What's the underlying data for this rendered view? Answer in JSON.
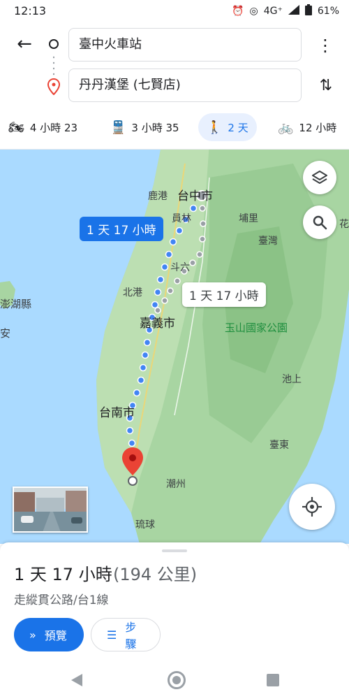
{
  "status_bar": {
    "time": "12:13",
    "network": "4G⁺",
    "battery": "61%"
  },
  "directions": {
    "origin": "臺中火車站",
    "destination": "丹丹漢堡 (七賢店)"
  },
  "modes": [
    {
      "icon": "motorcycle-icon",
      "label": "4 小時 23"
    },
    {
      "icon": "transit-icon",
      "label": "3 小時 35"
    },
    {
      "icon": "walk-icon",
      "label": "2 天",
      "active": true
    },
    {
      "icon": "bicycle-icon",
      "label": "12 小時"
    }
  ],
  "map": {
    "labels": {
      "taichung": "台中市",
      "lukang": "鹿港",
      "yuanlin": "員林",
      "puli": "埔里",
      "taiwan": "臺灣",
      "douliu": "斗六",
      "beigang": "北港",
      "chiayi": "嘉義市",
      "yushan": "玉山國家公園",
      "chishang": "池上",
      "tainan": "台南市",
      "taitung": "臺東",
      "chaozhou": "潮州",
      "liuqiu": "琉球",
      "penghu": "澎湖縣",
      "an": "安",
      "hua": "花"
    },
    "primary_route_duration": "1 天 17 小時",
    "alt_route_duration": "1 天 17 小時"
  },
  "summary": {
    "duration": "1 天 17 小時",
    "distance": "(194 公里)",
    "via": "走縱貫公路/台1線",
    "preview_label": "預覽",
    "steps_label": "步驟"
  },
  "colors": {
    "accent": "#1a73e8",
    "route": "#4285f4",
    "land": "#a8d5a2",
    "sea": "#aadaff",
    "pin": "#ea4335"
  }
}
